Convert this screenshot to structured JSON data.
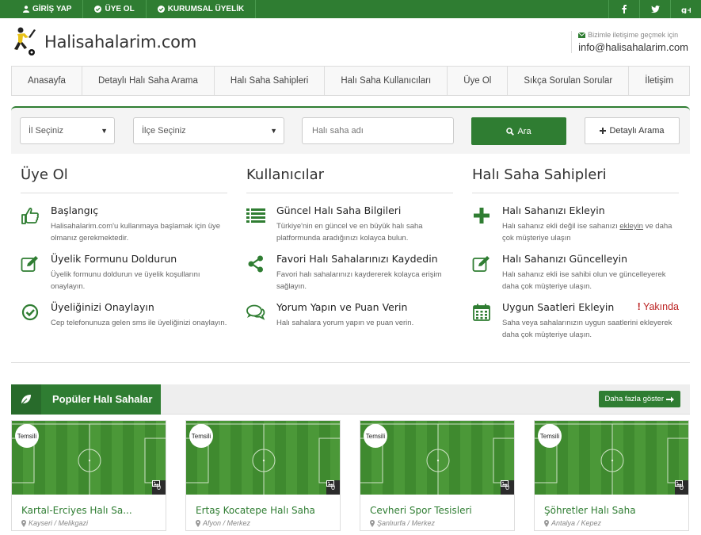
{
  "topbar": {
    "login": "GİRİŞ YAP",
    "register": "ÜYE OL",
    "corporate": "KURUMSAL ÜYELİK",
    "social": [
      "facebook-icon",
      "twitter-icon",
      "google-plus-icon"
    ]
  },
  "header": {
    "logo_text": "Halisahalarim.com",
    "contact_label": "Bizimle iletişime geçmek için",
    "contact_email": "info@halisahalarim.com"
  },
  "nav": [
    "Anasayfa",
    "Detaylı Halı Saha Arama",
    "Halı Saha Sahipleri",
    "Halı Saha Kullanıcıları",
    "Üye Ol",
    "Sıkça Sorulan Sorular",
    "İletişim"
  ],
  "search": {
    "city": "İl Seçiniz",
    "district": "İlçe Seçiniz",
    "name_placeholder": "Halı saha adı",
    "search_btn": "Ara",
    "detail_btn": "Detaylı Arama"
  },
  "columns": [
    {
      "title": "Üye Ol",
      "items": [
        {
          "icon": "thumbs-up-icon",
          "title": "Başlangıç",
          "text": "Halisahalarim.com'u kullanmaya başlamak için üye olmanız gerekmektedir."
        },
        {
          "icon": "edit-icon",
          "title": "Üyelik Formunu Doldurun",
          "text": "Üyelik formunu doldurun ve üyelik koşullarını onaylayın."
        },
        {
          "icon": "check-circle-icon",
          "title": "Üyeliğinizi Onaylayın",
          "text": "Cep telefonunuza gelen sms ile üyeliğinizi onaylayın."
        }
      ]
    },
    {
      "title": "Kullanıcılar",
      "items": [
        {
          "icon": "list-icon",
          "title": "Güncel Halı Saha Bilgileri",
          "text": "Türkiye'nin en güncel ve en büyük halı saha platformunda aradığınızı kolayca bulun."
        },
        {
          "icon": "share-icon",
          "title": "Favori Halı Sahalarınızı Kaydedin",
          "text": "Favori halı sahalarınızı kaydererek kolayca erişim sağlayın."
        },
        {
          "icon": "comments-icon",
          "title": "Yorum Yapın ve Puan Verin",
          "text": "Halı sahalara yorum yapın ve puan verin."
        }
      ]
    },
    {
      "title": "Halı Saha Sahipleri",
      "items": [
        {
          "icon": "plus-icon",
          "title": "Halı Sahanızı Ekleyin",
          "text_pre": "Halı sahanız ekli değil ise sahanızı ",
          "text_link": "ekleyin",
          "text_post": " ve daha çok müşteriye ulaşın"
        },
        {
          "icon": "edit-icon",
          "title": "Halı Sahanızı Güncelleyin",
          "text": "Halı sahanız ekli ise sahibi olun ve güncelleyerek daha çok müşteriye ulaşın."
        },
        {
          "icon": "calendar-icon",
          "title": "Uygun Saatleri Ekleyin",
          "text": "Saha veya sahalarınızın uygun saatlerini ekleyerek daha çok müşteriye ulaşın.",
          "badge": "Yakında"
        }
      ]
    }
  ],
  "popular": {
    "title": "Popüler Halı Sahalar",
    "more": "Daha fazla göster",
    "cards": [
      {
        "badge": "Temsili",
        "photos": "0",
        "name": "Kartal-Erciyes Halı Sa...",
        "location": "Kayseri / Melikgazi"
      },
      {
        "badge": "Temsili",
        "photos": "0",
        "name": "Ertaş Kocatepe Halı Saha",
        "location": "Afyon / Merkez"
      },
      {
        "badge": "Temsili",
        "photos": "0",
        "name": "Cevheri Spor Tesisleri",
        "location": "Şanlıurfa / Merkez"
      },
      {
        "badge": "Temsili",
        "photos": "0",
        "name": "Şöhretler Halı Saha",
        "location": "Antalya / Kepez"
      }
    ]
  },
  "colors": {
    "brand": "#2f7d32",
    "accent_red": "#bb2222"
  }
}
